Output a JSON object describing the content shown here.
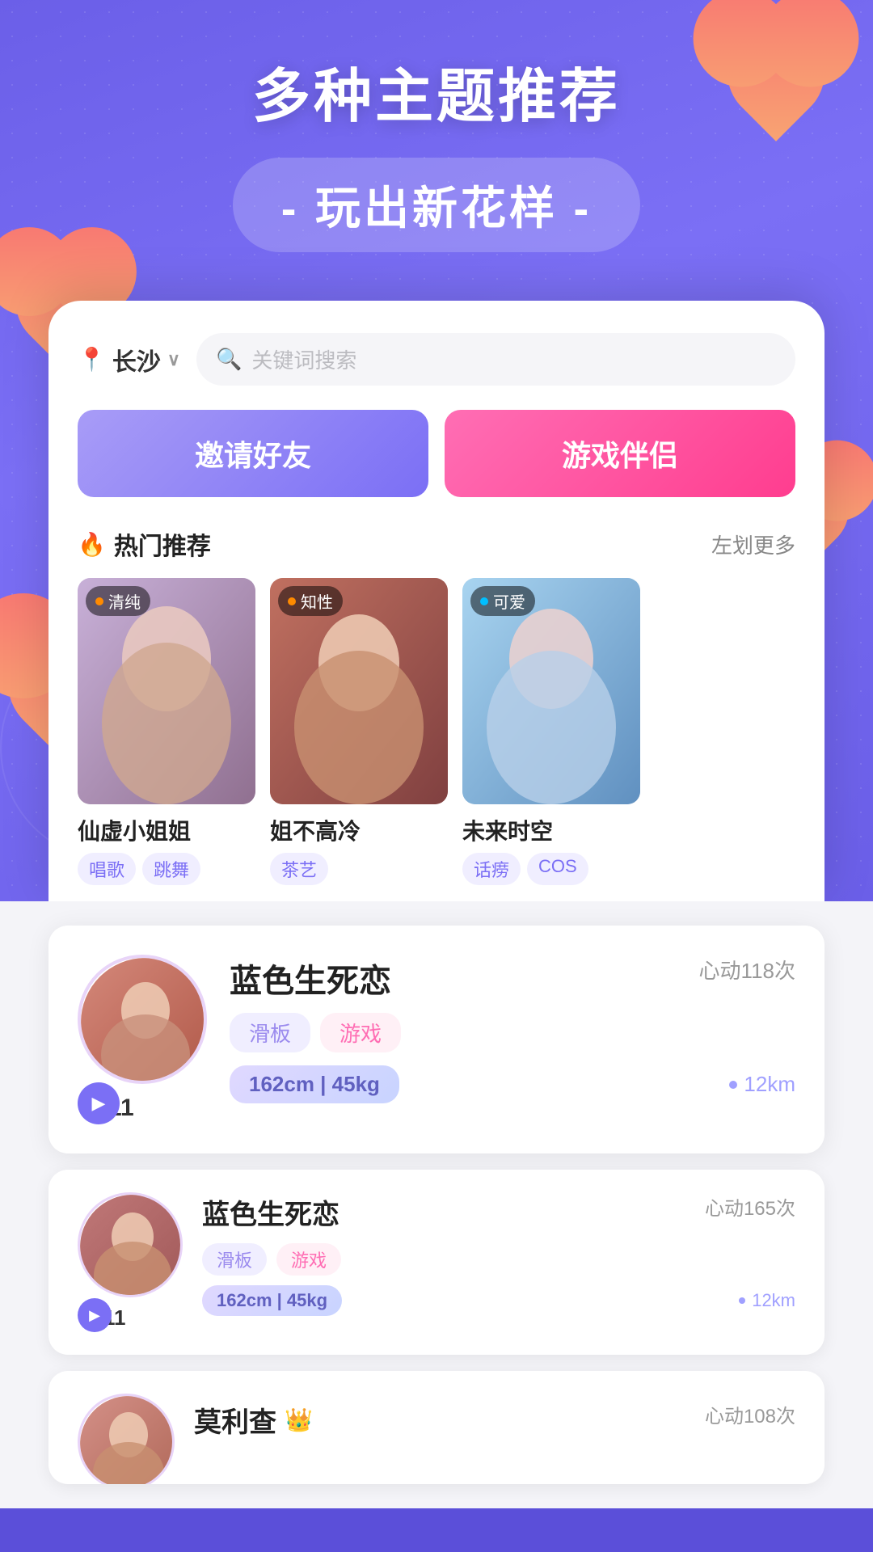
{
  "hero": {
    "title": "多种主题推荐",
    "subtitle": "- 玩出新花样 -",
    "dots_bg": true
  },
  "phone": {
    "location": "长沙",
    "search_placeholder": "关键词搜索",
    "btn_invite": "邀请好友",
    "btn_game": "游戏伴侣",
    "hot_section_title": "热门推荐",
    "hot_section_more": "左划更多",
    "profile_cards": [
      {
        "tag": "清纯",
        "tag_color": "orange",
        "name": "仙虚小姐姐",
        "tags": [
          "唱歌",
          "跳舞"
        ]
      },
      {
        "tag": "知性",
        "tag_color": "orange",
        "name": "姐不高冷",
        "tags": [
          "茶艺"
        ]
      },
      {
        "tag": "可爱",
        "tag_color": "blue",
        "name": "未来时空",
        "tags": [
          "话痨",
          "COS"
        ]
      }
    ]
  },
  "user_cards": [
    {
      "name": "蓝色生死恋",
      "heart_count": "心动118次",
      "tags_purple": [
        "滑板"
      ],
      "tags_pink": [
        "游戏"
      ],
      "height_weight": "162cm | 45kg",
      "distance": "12km",
      "wave_count": "11"
    },
    {
      "name": "蓝色生死恋",
      "heart_count": "心动165次",
      "tags_purple": [
        "滑板"
      ],
      "tags_pink": [
        "游戏"
      ],
      "height_weight": "162cm | 45kg",
      "distance": "12km",
      "wave_count": "11"
    },
    {
      "name": "莫利查",
      "heart_count": "心动108次",
      "has_crown": true
    }
  ],
  "icons": {
    "location": "📍",
    "search": "🔍",
    "fire": "🔥",
    "play": "▶",
    "wave": "〜",
    "dot": "•",
    "crown": "👑",
    "chevron": "∨"
  }
}
